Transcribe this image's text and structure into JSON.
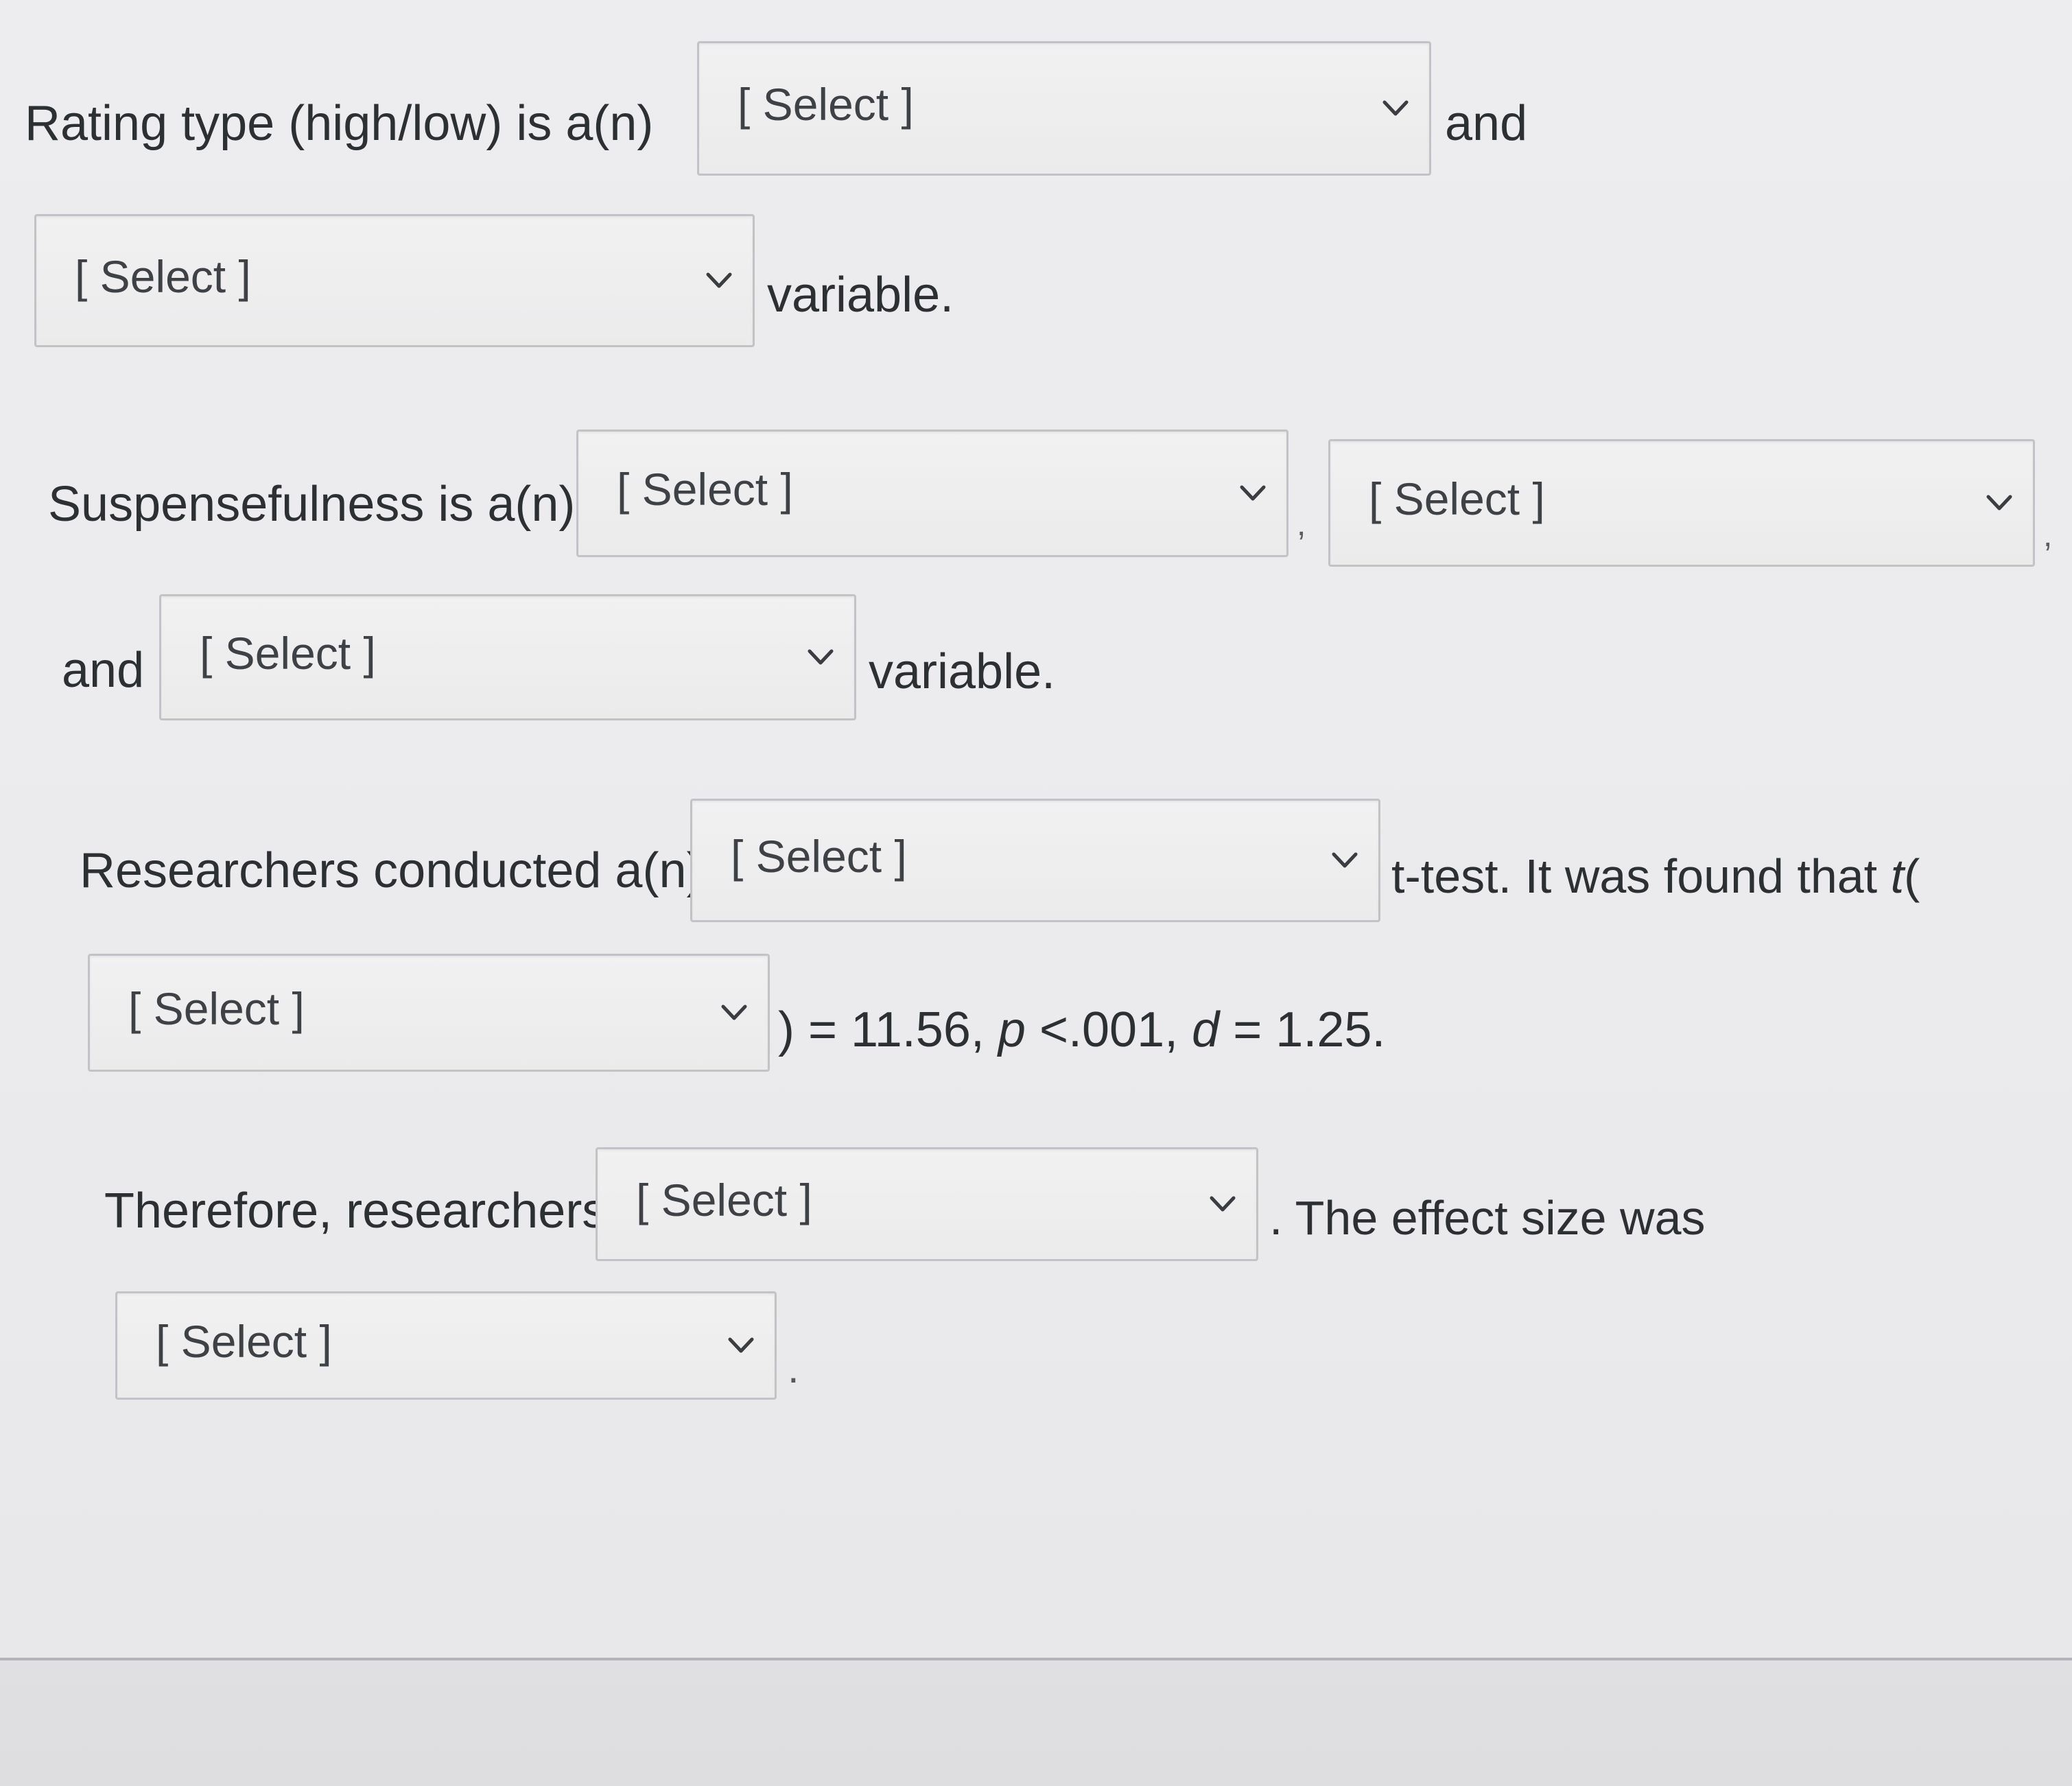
{
  "question": {
    "sentence1": {
      "prefix": "Rating type (high/low) is a(n)",
      "dropdown1": {
        "value": "[ Select ]"
      },
      "connector": "and",
      "dropdown2": {
        "value": "[ Select ]"
      },
      "suffix": "variable."
    },
    "sentence2": {
      "prefix": "Suspensefulness is a(n)",
      "dropdown1": {
        "value": "[ Select ]"
      },
      "comma1": ",",
      "dropdown2": {
        "value": "[ Select ]"
      },
      "comma2": ",",
      "connector": "and",
      "dropdown3": {
        "value": "[ Select ]"
      },
      "suffix": "variable."
    },
    "sentence3": {
      "prefix": "Researchers conducted a(n)",
      "dropdown1": {
        "value": "[ Select ]"
      },
      "middle_text": "t-test. It was found that",
      "t_symbol": "t",
      "open_paren": "(",
      "dropdown2": {
        "value": "[ Select ]"
      },
      "result": {
        "close_paren_equals": ") = 11.56,",
        "p_symbol": "p",
        "p_value": "<.001,",
        "d_symbol": "d",
        "d_value": "= 1.25."
      }
    },
    "sentence4": {
      "prefix": "Therefore, researchers",
      "dropdown1": {
        "value": "[ Select ]"
      },
      "middle_text": ". The effect size was",
      "dropdown2": {
        "value": "[ Select ]"
      },
      "end_period": "."
    }
  },
  "icons": {
    "dropdown_indicator": "chevron-down-icon"
  },
  "colors": {
    "text": "#2d3033",
    "dropdown_bg": "#eeeeef",
    "dropdown_border": "#c3c3c7",
    "page_bg": "#ebebed"
  }
}
